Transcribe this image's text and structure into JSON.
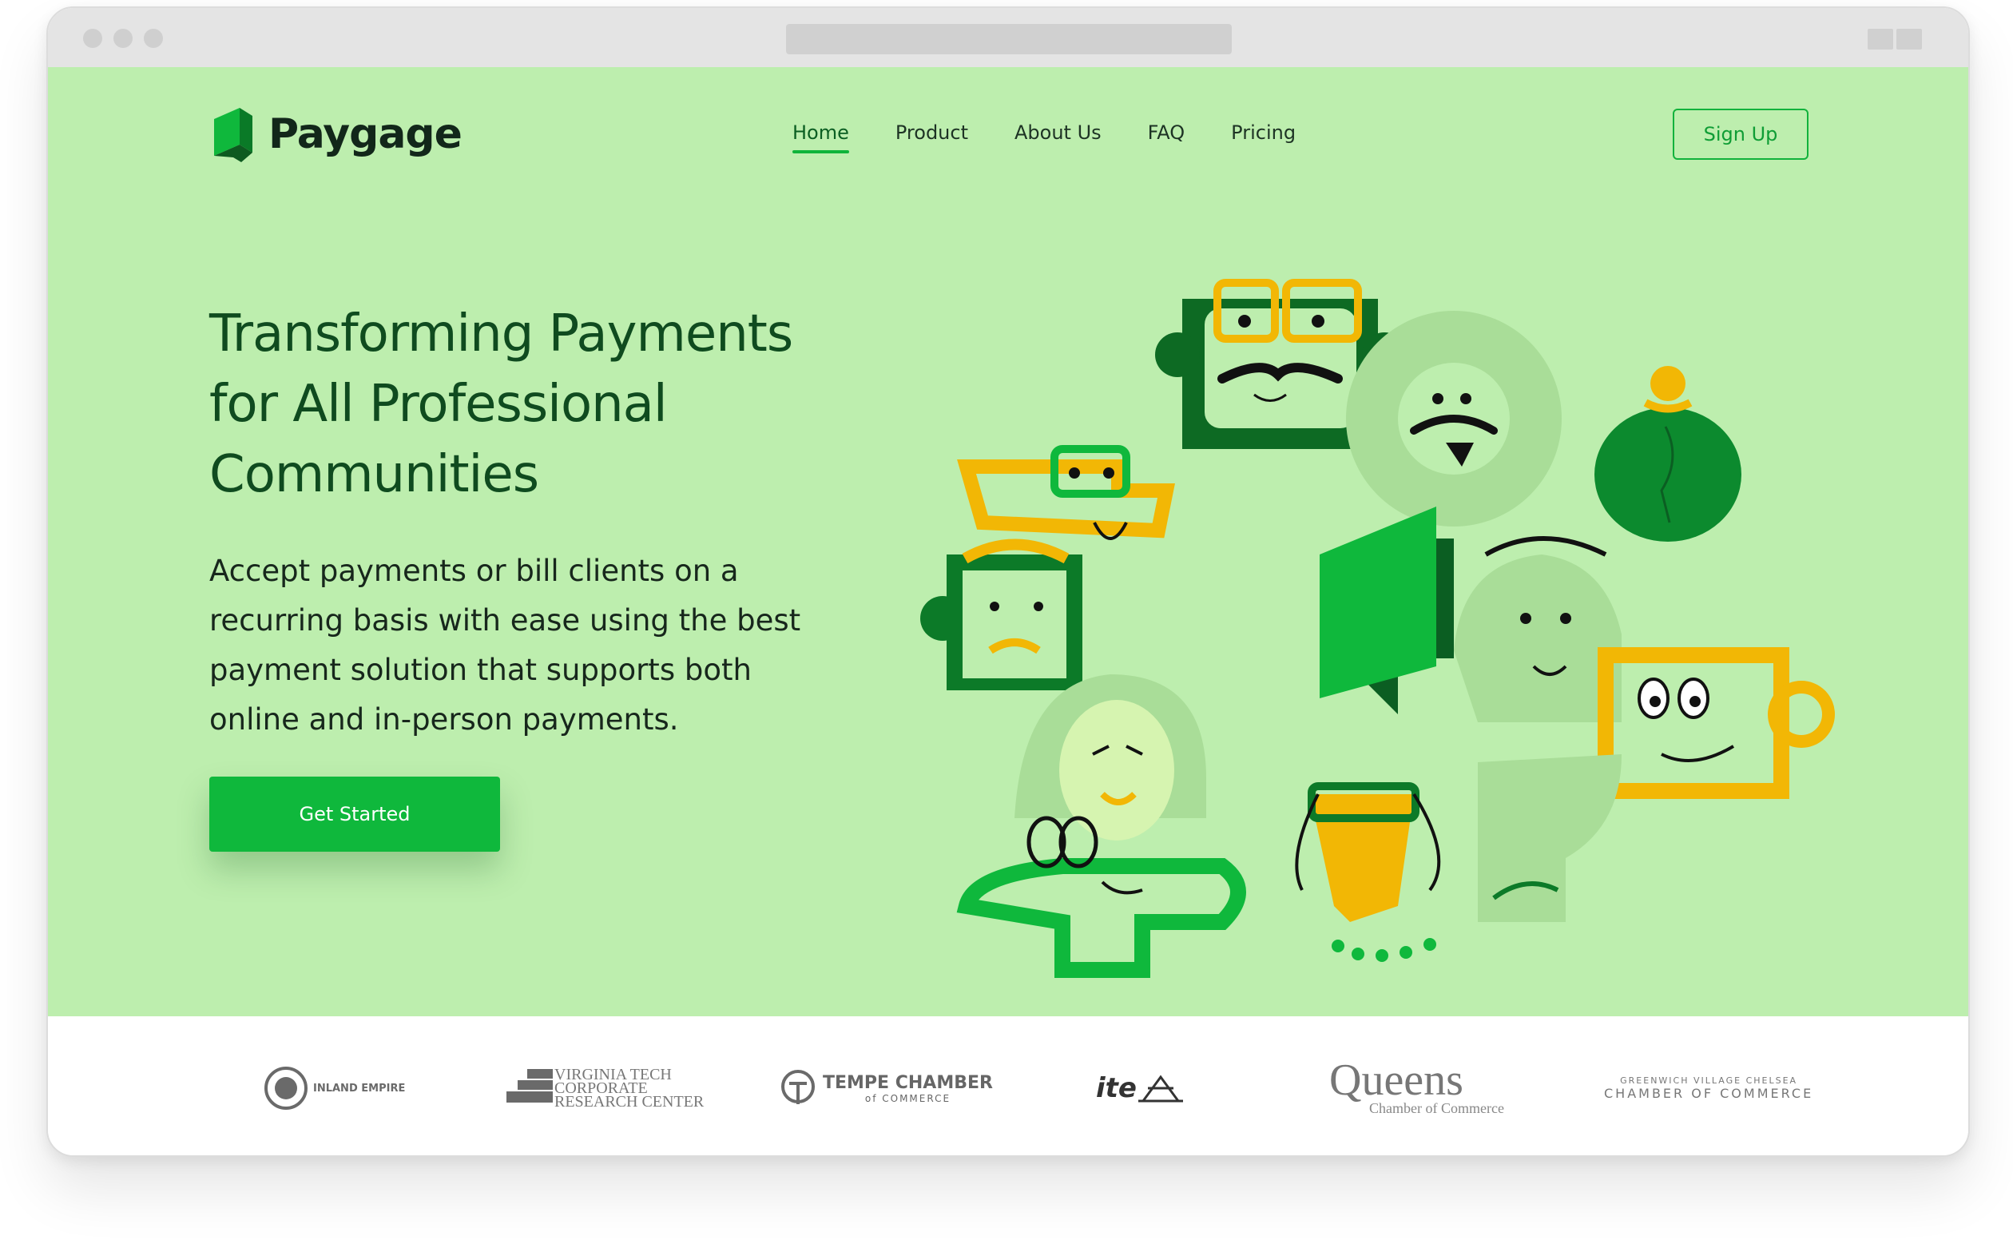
{
  "window": {
    "colors": {
      "hero_bg": "#bdeeae",
      "accent": "#0fb83c",
      "brand_dark": "#0f4b1f"
    }
  },
  "header": {
    "brand": "Paygage",
    "nav": [
      {
        "label": "Home",
        "active": true
      },
      {
        "label": "Product",
        "active": false
      },
      {
        "label": "About Us",
        "active": false
      },
      {
        "label": "FAQ",
        "active": false
      },
      {
        "label": "Pricing",
        "active": false
      }
    ],
    "signup_label": "Sign Up"
  },
  "hero": {
    "headline_lines": [
      "Transforming Payments",
      "for All Professional",
      "Communities"
    ],
    "subtext_lines": [
      "Accept payments or bill clients on a",
      "recurring basis with ease using the best",
      "payment solution that supports both",
      "online and in-person payments."
    ],
    "cta_label": "Get Started"
  },
  "partners": {
    "inland_empire": "INLAND EMPIRE",
    "virginia_tech": [
      "VIRGINIA TECH",
      "CORPORATE",
      "RESEARCH CENTER"
    ],
    "tempe": [
      "TEMPE CHAMBER",
      "of COMMERCE"
    ],
    "ite": "ite",
    "queens": [
      "Queens",
      "Chamber of Commerce"
    ],
    "greenwich": [
      "GREENWICH VILLAGE",
      "CHELSEA",
      "CHAMBER OF COMMERCE"
    ]
  }
}
